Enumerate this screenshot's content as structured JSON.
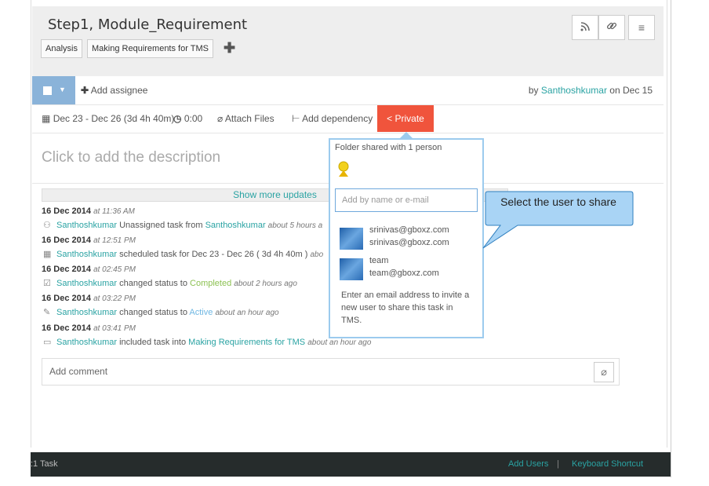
{
  "task": {
    "title": "Step1, Module_Requirement",
    "tags": [
      "Analysis",
      "Making Requirements for TMS"
    ]
  },
  "toolbar": {
    "add_assignee": "Add assignee",
    "by_prefix": "by",
    "author": "Santhoshkumar",
    "on_date": "on Dec 15",
    "date_range": "Dec 23 - Dec 26 (3d 4h 40m)",
    "time": "0:00",
    "attach_files": "Attach Files",
    "add_dependency": "Add dependency",
    "private": "Private"
  },
  "description_placeholder": "Click to add the description",
  "updates": {
    "show_more": "Show more updates",
    "entries": [
      {
        "date": "16 Dec 2014",
        "time": "at 11:36 AM",
        "user": "Santhoshkumar",
        "action": "Unassigned task from",
        "target": "Santhoshkumar",
        "ago": "about 5 hours a"
      },
      {
        "date": "16 Dec 2014",
        "time": "at 12:51 PM",
        "user": "Santhoshkumar",
        "action": "scheduled task for Dec 23 - Dec 26 ( 3d 4h 40m )",
        "ago": "abo"
      },
      {
        "date": "16 Dec 2014",
        "time": "at 02:45 PM",
        "user": "Santhoshkumar",
        "action": "changed status to",
        "status": "Completed",
        "ago": "about 2 hours ago"
      },
      {
        "date": "16 Dec 2014",
        "time": "at 03:22 PM",
        "user": "Santhoshkumar",
        "action": "changed status to",
        "status": "Active",
        "ago": "about an hour ago"
      },
      {
        "date": "16 Dec 2014",
        "time": "at 03:41 PM",
        "user": "Santhoshkumar",
        "action": "included task into",
        "target": "Making Requirements for TMS",
        "ago": "about an hour ago"
      }
    ]
  },
  "comment_placeholder": "Add comment",
  "share_popup": {
    "header": "Folder shared with 1 person",
    "input_placeholder": "Add by name or e-mail",
    "users": [
      {
        "name": "srinivas@gboxz.com",
        "email": "srinivas@gboxz.com"
      },
      {
        "name": "team",
        "email": "team@gboxz.com"
      }
    ],
    "note": "Enter an email address to invite a new user to share this task in TMS."
  },
  "callout": "Select the user to share",
  "footer": {
    "left": ":1 Task",
    "add_users": "Add Users",
    "divider": "|",
    "keyboard_shortcut": "Keyboard Shortcut"
  },
  "colors": {
    "accent": "#2aa3a3",
    "private": "#f0543c",
    "footer_bg": "#262c2c",
    "callout_fill": "#a9d4f5"
  },
  "icons": [
    "rss-icon",
    "link-icon",
    "menu-icon",
    "plus-icon",
    "calendar-icon",
    "clock-icon",
    "paperclip-icon",
    "dependency-icon",
    "share-icon"
  ]
}
